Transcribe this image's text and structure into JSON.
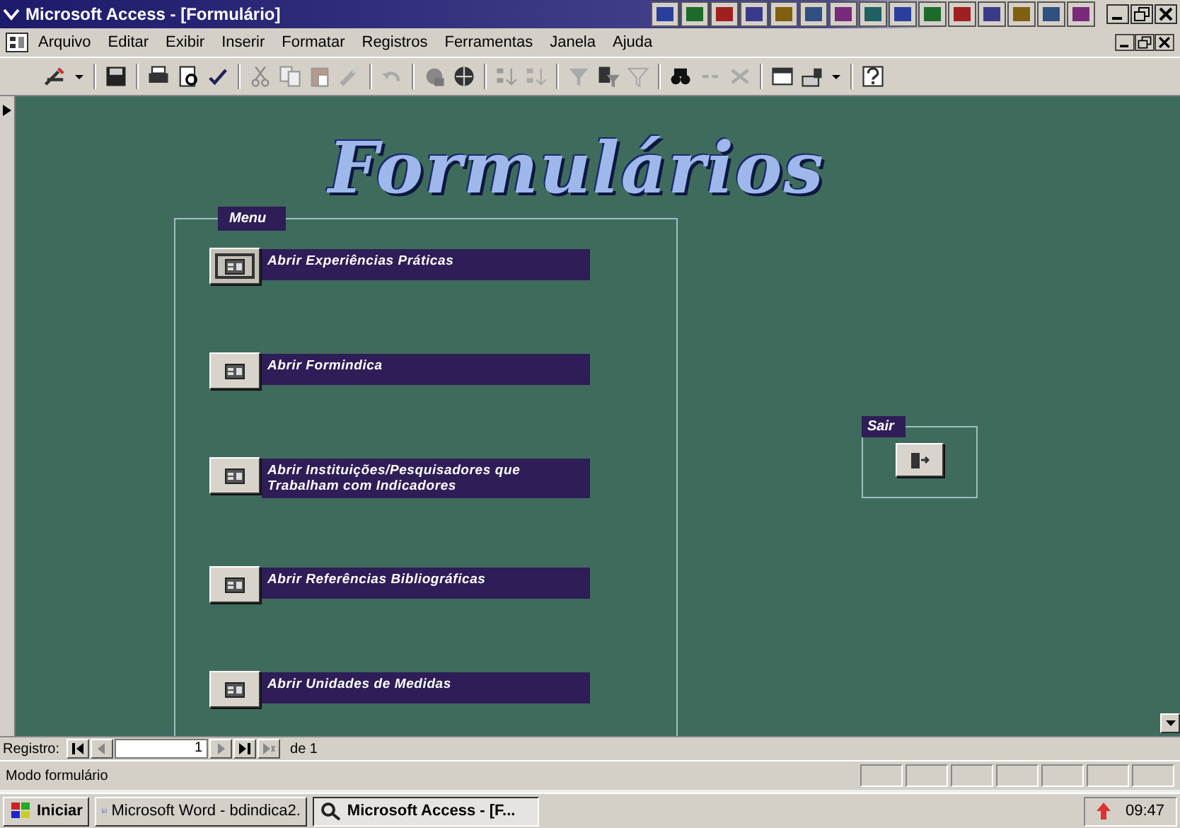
{
  "window": {
    "title": "Microsoft Access - [Formulário]"
  },
  "menu_bar": {
    "items": [
      {
        "label": "Arquivo"
      },
      {
        "label": "Editar"
      },
      {
        "label": "Exibir"
      },
      {
        "label": "Inserir"
      },
      {
        "label": "Formatar"
      },
      {
        "label": "Registros"
      },
      {
        "label": "Ferramentas"
      },
      {
        "label": "Janela"
      },
      {
        "label": "Ajuda"
      }
    ]
  },
  "form": {
    "title": "Formulários",
    "menu_group": {
      "label": "Menu",
      "buttons": [
        {
          "label": "Abrir Experiências Práticas",
          "focused": true
        },
        {
          "label": "Abrir Formindica",
          "focused": false
        },
        {
          "label": "Abrir Instituições/Pesquisadores que Trabalham com Indicadores",
          "focused": false
        },
        {
          "label": "Abrir Referências Bibliográficas",
          "focused": false
        },
        {
          "label": "Abrir Unidades de Medidas",
          "focused": false
        }
      ]
    },
    "exit_group": {
      "label": "Sair"
    }
  },
  "navigation": {
    "label": "Registro:",
    "record": "1",
    "total": "de 1"
  },
  "status_bar": {
    "text": "Modo formulário"
  },
  "taskbar": {
    "start": "Iniciar",
    "tasks": [
      {
        "kind": "word",
        "label": "Microsoft Word - bdindica2.",
        "selected": false
      },
      {
        "kind": "access",
        "label": "Microsoft Access - [F...",
        "selected": true
      }
    ],
    "clock": "09:47"
  }
}
